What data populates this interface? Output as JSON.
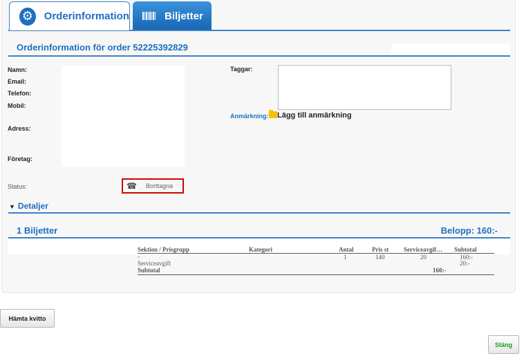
{
  "tabs": [
    {
      "label": "Orderinformation",
      "icon": "gear-icon",
      "active": true
    },
    {
      "label": "Biljetter",
      "icon": "barcode-icon",
      "active": false
    }
  ],
  "order": {
    "title": "Orderinformation för order 52225392829"
  },
  "customer": {
    "labels": [
      "Namn:",
      "Email:",
      "Telefon:",
      "Mobil:",
      "Adress:",
      "Företag:"
    ]
  },
  "tags": {
    "label": "Taggar:",
    "value": ""
  },
  "remark": {
    "label": "Anmärkning:",
    "link": "Lägg till anmärkning"
  },
  "status": {
    "label": "Status:",
    "value": "Borttagna",
    "icon": "phone-icon"
  },
  "details": {
    "label": "Detaljer"
  },
  "tickets": {
    "count_label": "1 Biljetter",
    "amount_label": "Belopp: 160:-",
    "headers": [
      "Sektion / Prisgrupp",
      "Kategori",
      "Antal",
      "Pris st",
      "Serviceavgif…",
      "Subtotal"
    ],
    "row": {
      "section": "-",
      "antal": "1",
      "pris": "140",
      "service": "20",
      "subtotal": "160:-"
    },
    "service_label": "Serviceavgift",
    "service_value": "20:-",
    "subtotal_label": "Subtotal",
    "subtotal_value": "160:-"
  },
  "buttons": {
    "receipt": "Hämta kvitto",
    "close": "Stäng"
  },
  "colors": {
    "accent": "#1e6fc0",
    "status_outline": "#d10000",
    "close_text": "#1f9a24"
  }
}
